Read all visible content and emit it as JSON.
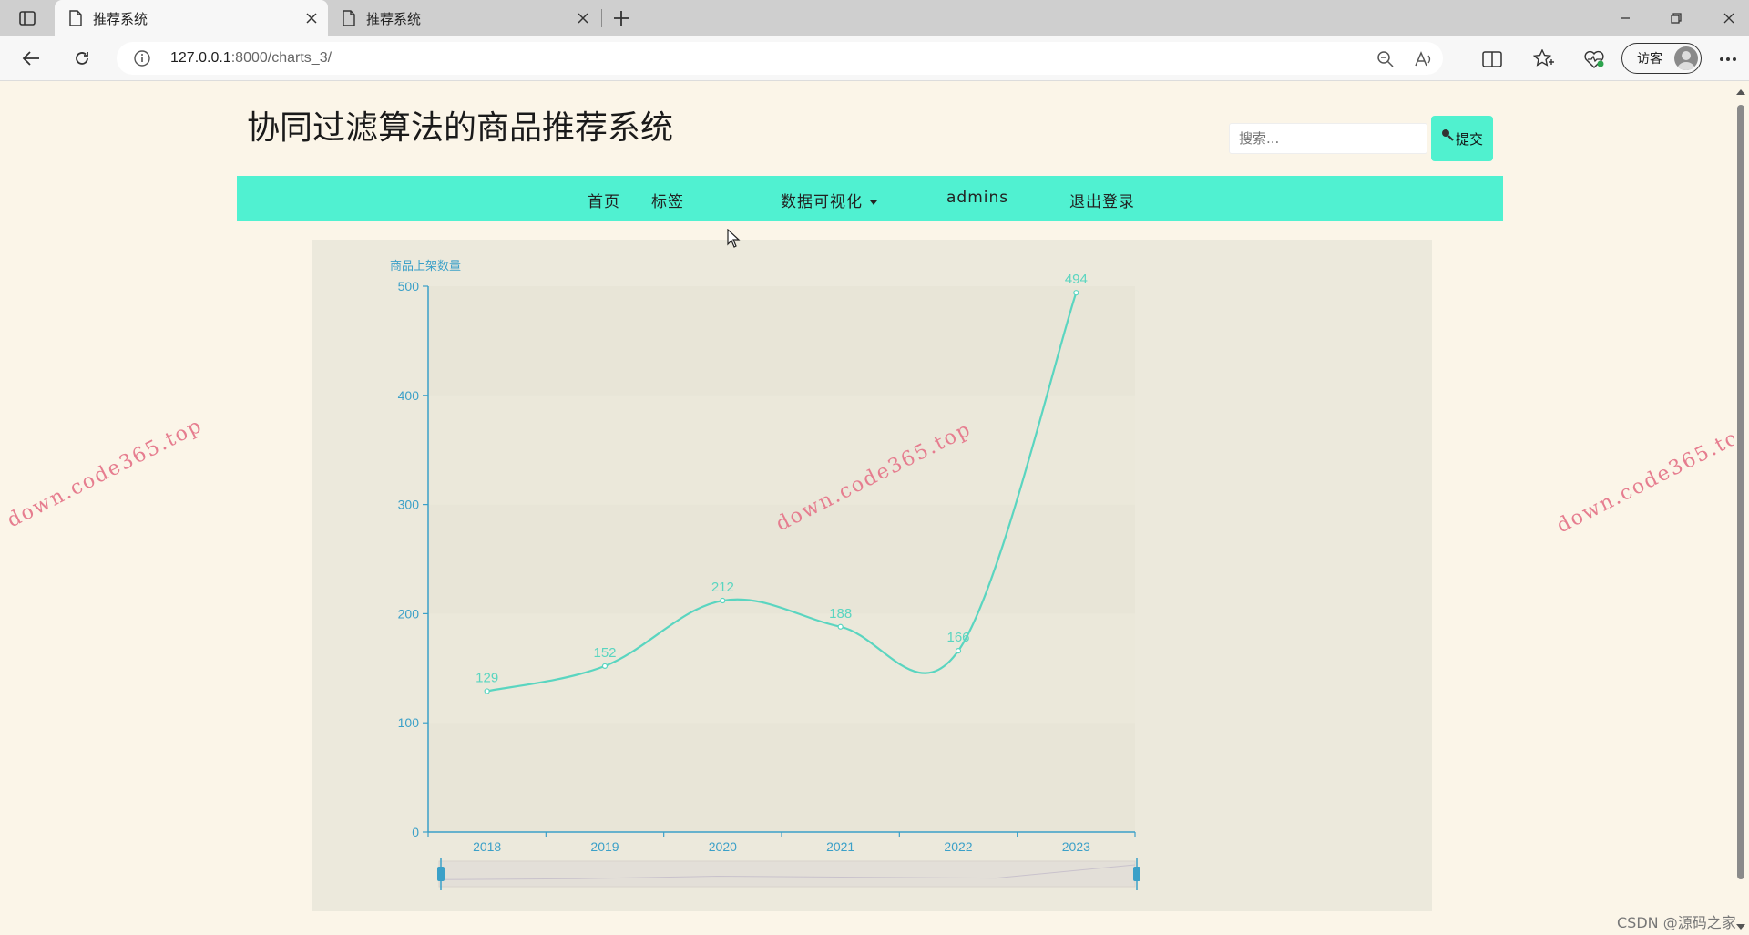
{
  "browser": {
    "tabs": [
      {
        "title": "推荐系统",
        "active": true
      },
      {
        "title": "推荐系统",
        "active": false
      }
    ],
    "url_host": "127.0.0.1",
    "url_rest": ":8000/charts_3/",
    "guest_label": "访客"
  },
  "site": {
    "title": "协同过滤算法的商品推荐系统",
    "search_placeholder": "搜索...",
    "search_button": "提交",
    "nav": [
      {
        "label": "首页"
      },
      {
        "label": "标签"
      },
      {
        "label": "数据可视化",
        "has_dropdown": true
      },
      {
        "label": "admins"
      },
      {
        "label": "退出登录"
      }
    ]
  },
  "watermark_text": "down.code365.top",
  "footer_credit": "CSDN @源码之家",
  "colors": {
    "accent": "#50f1d1",
    "series": "#5ad5c0",
    "axis": "#3ba0c8",
    "page_bg": "#fbf5e8",
    "chart_bg": "#ece9dc"
  },
  "chart_data": {
    "type": "line",
    "smooth": true,
    "ylabel": "商品上架数量",
    "categories": [
      "2018",
      "2019",
      "2020",
      "2021",
      "2022",
      "2023"
    ],
    "values": [
      129,
      152,
      212,
      188,
      166,
      494
    ],
    "ylim": [
      0,
      500
    ],
    "yticks": [
      0,
      100,
      200,
      300,
      400,
      500
    ],
    "data_labels": true,
    "datazoom_slider": true
  }
}
